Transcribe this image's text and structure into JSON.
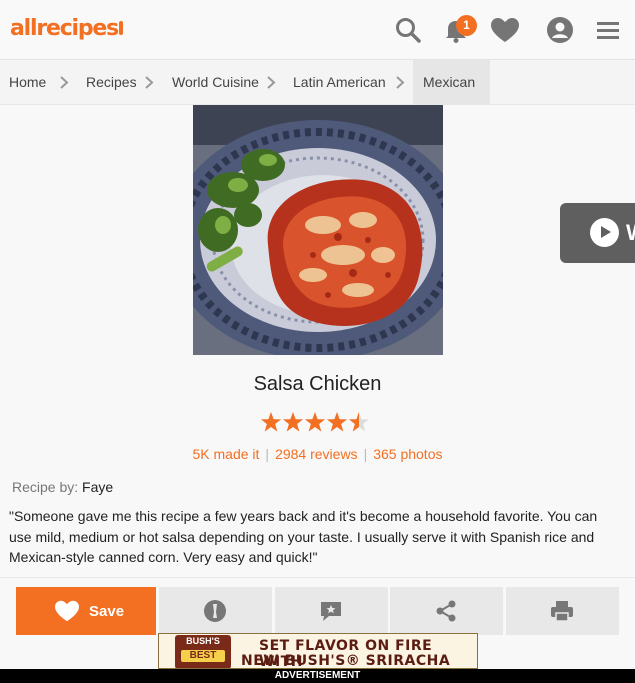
{
  "header": {
    "logo_text": "allrecipes",
    "notification_count": "1",
    "icons": [
      "search-icon",
      "bell-icon",
      "heart-icon",
      "profile-icon",
      "menu-icon"
    ]
  },
  "breadcrumb": {
    "items": [
      "Home",
      "Recipes",
      "World Cuisine",
      "Latin American",
      "Mexican"
    ]
  },
  "video": {
    "label": "W"
  },
  "recipe": {
    "title": "Salsa Chicken",
    "rating": 4.5,
    "made_it": "5K made it",
    "reviews": "2984 reviews",
    "photos": "365 photos",
    "recipe_by_label": "Recipe by:",
    "author": "Faye",
    "description": "\"Someone gave me this recipe a few years back and it's become a household favorite. You can use mild, medium or hot salsa depending on your taste. I usually serve it with Spanish rice and Mexican-style canned corn. Very easy and quick!\""
  },
  "actions": {
    "save_label": "Save",
    "icons": [
      "made-it-icon",
      "review-icon",
      "share-icon",
      "print-icon"
    ]
  },
  "ad": {
    "can_top": "BUSH'S",
    "can_brand": "BEST",
    "line1": "SET FLAVOR ON FIRE WITH",
    "line2": "NEW BUSH'S® SRIRACHA BEANS",
    "label": "ADVERTISEMENT"
  },
  "colors": {
    "accent": "#f36f21",
    "header_bg": "#f9f9f9",
    "action_bg": "#e8e8e8"
  }
}
